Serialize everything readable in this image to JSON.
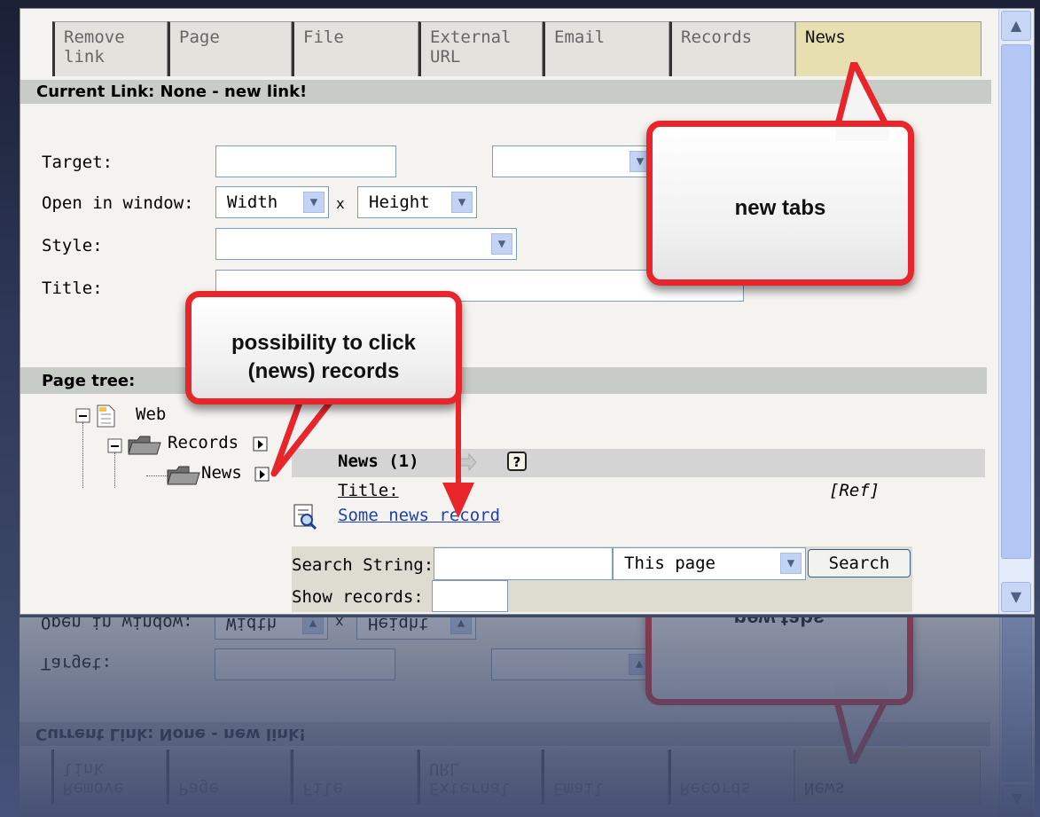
{
  "tabs": [
    "Remove link",
    "Page",
    "File",
    "External URL",
    "Email",
    "Records",
    "News"
  ],
  "active_tab": "News",
  "current_link": "Current Link: None - new link!",
  "form": {
    "target_label": "Target:",
    "open_in_window_label": "Open in window:",
    "width_option": "Width",
    "times": "x",
    "height_option": "Height",
    "style_label": "Style:",
    "title_label": "Title:"
  },
  "page_tree": {
    "header": "Page tree:",
    "nodes": [
      "Webpage",
      "Records",
      "News"
    ],
    "root_visible_text": "Web"
  },
  "records": {
    "section_title": "News (1)",
    "column_title": "Title:",
    "column_ref": "[Ref]",
    "record_link": "Some news record"
  },
  "search": {
    "label": "Search String:",
    "scope": "This page",
    "button": "Search",
    "show_records_label": "Show records:"
  },
  "callouts": {
    "new_tabs": "new tabs",
    "possibility": "possibility to click (news) records"
  },
  "colors": {
    "callout_border": "#e8252a",
    "active_tab": "#e8dfb0",
    "link": "#1e3fb0"
  }
}
